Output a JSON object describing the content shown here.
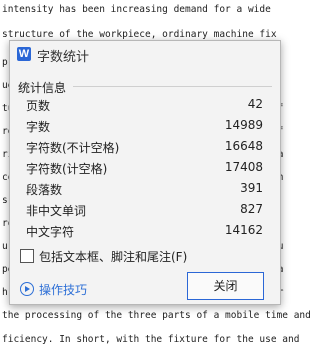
{
  "document": {
    "top_line_1": "intensity has been increasing demand for a wide",
    "top_line_2": "structure of the workpiece, ordinary machine fix",
    "left_fragments": [
      "pr",
      "ue",
      "tu",
      "re",
      "ri",
      "co",
      "s",
      "ro",
      "ur",
      "pe",
      "h",
      "m",
      "it",
      "s",
      "h"
    ],
    "right_fragments": [
      "of",
      "of",
      "ta",
      "th",
      "au",
      "ia",
      "or",
      "e e",
      "an"
    ],
    "bottom_line_1": "the processing of the three parts of a mobile time and",
    "bottom_line_2": "ficiency. In short, with the fixture for the use and"
  },
  "dialog": {
    "title": "字数统计",
    "app_icon_letter": "W",
    "group_title": "统计信息",
    "stats": [
      {
        "label": "页数",
        "value": "42"
      },
      {
        "label": "字数",
        "value": "14989"
      },
      {
        "label": "字符数(不计空格)",
        "value": "16648"
      },
      {
        "label": "字符数(计空格)",
        "value": "17408"
      },
      {
        "label": "段落数",
        "value": "391"
      },
      {
        "label": "非中文单词",
        "value": "827"
      },
      {
        "label": "中文字符",
        "value": "14162"
      }
    ],
    "checkbox_label": "包括文本框、脚注和尾注(F)",
    "checkbox_checked": false,
    "tips_label": "操作技巧",
    "close_label": "关闭"
  }
}
